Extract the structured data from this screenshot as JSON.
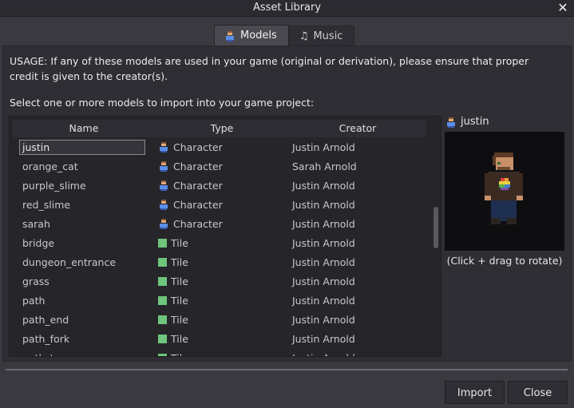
{
  "window": {
    "title": "Asset Library"
  },
  "tabs": [
    {
      "label": "Models",
      "icon": "character-icon",
      "active": true
    },
    {
      "label": "Music",
      "icon": "music-note-icon",
      "active": false
    }
  ],
  "usage_text": "USAGE: If any of these models are used in your game (original or derivation), please ensure that proper credit is given to the creator(s).",
  "select_label": "Select one or more models to import into your game project:",
  "table": {
    "columns": [
      "Name",
      "Type",
      "Creator"
    ],
    "rows": [
      {
        "name": "justin",
        "type": "Character",
        "icon": "character-icon",
        "creator": "Justin Arnold",
        "selected": true
      },
      {
        "name": "orange_cat",
        "type": "Character",
        "icon": "character-icon",
        "creator": "Sarah Arnold"
      },
      {
        "name": "purple_slime",
        "type": "Character",
        "icon": "character-icon",
        "creator": "Justin Arnold"
      },
      {
        "name": "red_slime",
        "type": "Character",
        "icon": "character-icon",
        "creator": "Justin Arnold"
      },
      {
        "name": "sarah",
        "type": "Character",
        "icon": "character-icon",
        "creator": "Justin Arnold"
      },
      {
        "name": "bridge",
        "type": "Tile",
        "icon": "tile-icon",
        "creator": "Justin Arnold"
      },
      {
        "name": "dungeon_entrance",
        "type": "Tile",
        "icon": "tile-icon",
        "creator": "Justin Arnold"
      },
      {
        "name": "grass",
        "type": "Tile",
        "icon": "tile-icon",
        "creator": "Justin Arnold"
      },
      {
        "name": "path",
        "type": "Tile",
        "icon": "tile-icon",
        "creator": "Justin Arnold"
      },
      {
        "name": "path_end",
        "type": "Tile",
        "icon": "tile-icon",
        "creator": "Justin Arnold"
      },
      {
        "name": "path_fork",
        "type": "Tile",
        "icon": "tile-icon",
        "creator": "Justin Arnold"
      },
      {
        "name": "path_turn",
        "type": "Tile",
        "icon": "tile-icon",
        "creator": "Justin Arnold"
      }
    ]
  },
  "preview": {
    "title": "justin",
    "caption": "(Click + drag to rotate)"
  },
  "buttons": {
    "import": "Import",
    "close": "Close"
  },
  "colors": {
    "background": "#3a3940",
    "panel": "#2f2e34",
    "tile_green": "#6ec57c"
  }
}
